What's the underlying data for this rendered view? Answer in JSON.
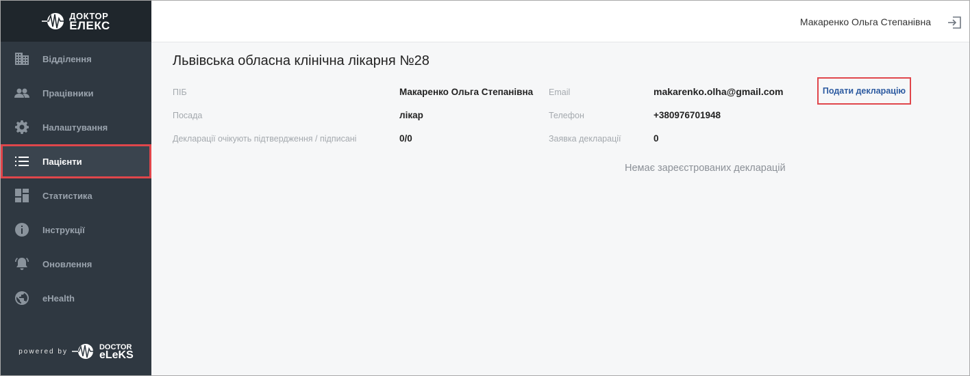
{
  "app": {
    "logo_line1": "ДОКТОР",
    "logo_line2": "ЕЛЕКС",
    "powered_by": "powered by",
    "powered_logo_line1": "DOCTOR",
    "powered_logo_line2": "eLeKS"
  },
  "sidebar": {
    "items": [
      {
        "label": "Відділення",
        "icon": "building-icon"
      },
      {
        "label": "Працівники",
        "icon": "people-icon"
      },
      {
        "label": "Налаштування",
        "icon": "gear-icon"
      },
      {
        "label": "Пацієнти",
        "icon": "list-icon",
        "active": true
      },
      {
        "label": "Статистика",
        "icon": "dashboard-icon"
      },
      {
        "label": "Інструкції",
        "icon": "info-icon"
      },
      {
        "label": "Оновлення",
        "icon": "bell-icon"
      },
      {
        "label": "eHealth",
        "icon": "globe-icon"
      }
    ]
  },
  "header": {
    "user_name": "Макаренко Ольга Степанівна",
    "logout_icon": "logout-icon"
  },
  "main": {
    "hospital_name": "Львівська обласна клінічна лікарня №28",
    "fields": {
      "name_label": "ПІБ",
      "name_value": "Макаренко Ольга Степанівна",
      "position_label": "Посада",
      "position_value": "лікар",
      "declarations_label": "Декларації очікують підтвердження / підписані",
      "declarations_value": "0/0",
      "email_label": "Email",
      "email_value": "makarenko.olha@gmail.com",
      "phone_label": "Телефон",
      "phone_value": "+380976701948",
      "request_label": "Заявка декларації",
      "request_value": "0"
    },
    "declare_button": "Подати декларацію",
    "empty_message": "Немає зареєстрованих декларацій"
  },
  "colors": {
    "sidebar_bg": "#2f3841",
    "logo_bar_bg": "#1f262c",
    "highlight": "#e0464b",
    "link": "#2c5aa0"
  }
}
